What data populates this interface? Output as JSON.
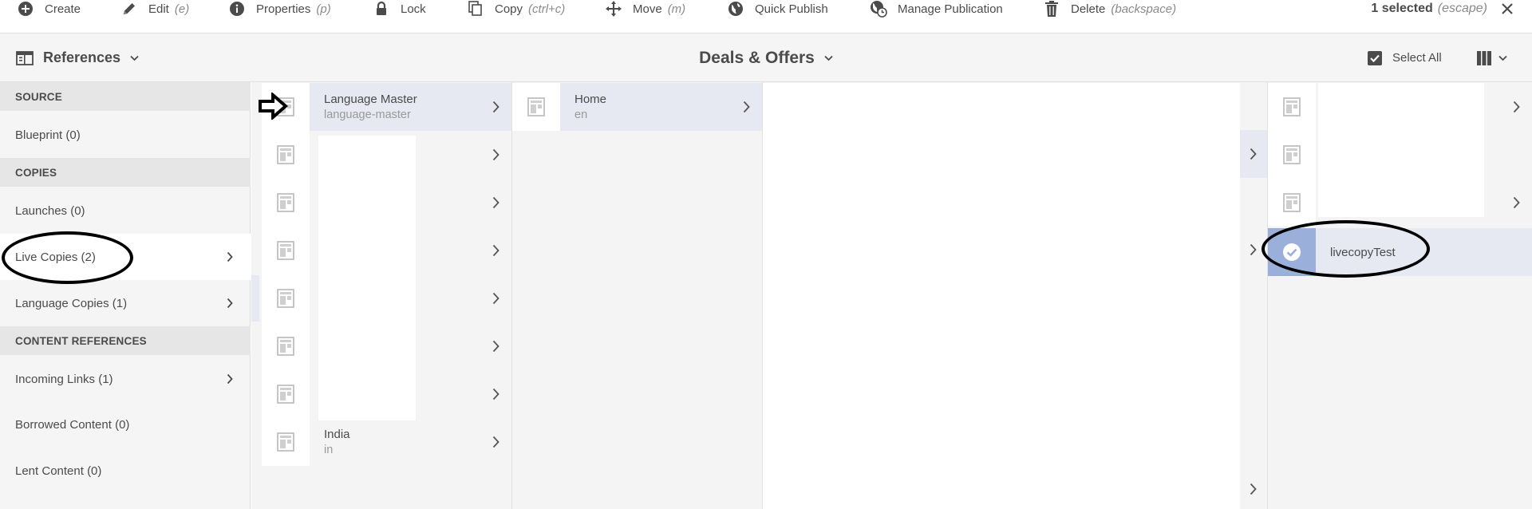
{
  "actionbar": {
    "actions": [
      {
        "label": "Create",
        "shortcut": "",
        "icon": "plus-circle-icon"
      },
      {
        "label": "Edit",
        "shortcut": "(e)",
        "icon": "pencil-icon"
      },
      {
        "label": "Properties",
        "shortcut": "(p)",
        "icon": "info-icon"
      },
      {
        "label": "Lock",
        "shortcut": "",
        "icon": "lock-icon"
      },
      {
        "label": "Copy",
        "shortcut": "(ctrl+c)",
        "icon": "copy-icon"
      },
      {
        "label": "Move",
        "shortcut": "(m)",
        "icon": "move-icon"
      },
      {
        "label": "Quick Publish",
        "shortcut": "",
        "icon": "globe-icon"
      },
      {
        "label": "Manage Publication",
        "shortcut": "",
        "icon": "globe-clock-icon"
      },
      {
        "label": "Delete",
        "shortcut": "(backspace)",
        "icon": "trash-icon"
      }
    ],
    "selection": {
      "count_label": "1 selected",
      "shortcut": "(escape)"
    }
  },
  "header": {
    "rail_toggle_label": "References",
    "title": "Deals & Offers",
    "select_all_label": "Select All"
  },
  "rail": {
    "sections": {
      "source": "SOURCE",
      "copies": "COPIES",
      "content_refs": "CONTENT REFERENCES"
    },
    "items": {
      "blueprint": "Blueprint (0)",
      "launches": "Launches (0)",
      "live_copies": "Live Copies (2)",
      "language_copies": "Language Copies (1)",
      "incoming_links": "Incoming Links (1)",
      "borrowed_content": "Borrowed Content (0)",
      "lent_content": "Lent Content (0)"
    }
  },
  "columns": {
    "col1": {
      "first": {
        "title": "Language Master",
        "subtitle": "language-master"
      },
      "last": {
        "title": "India",
        "subtitle": "in"
      }
    },
    "col2": {
      "first": {
        "title": "Home",
        "subtitle": "en"
      }
    },
    "col4": {
      "selected": {
        "title": "livecopyTest"
      }
    }
  },
  "colors": {
    "highlight": "#e6e9f2",
    "selected_thumb": "#9ab0db",
    "rail_section_bg": "#e6e6e6",
    "annotation": "#000000"
  }
}
